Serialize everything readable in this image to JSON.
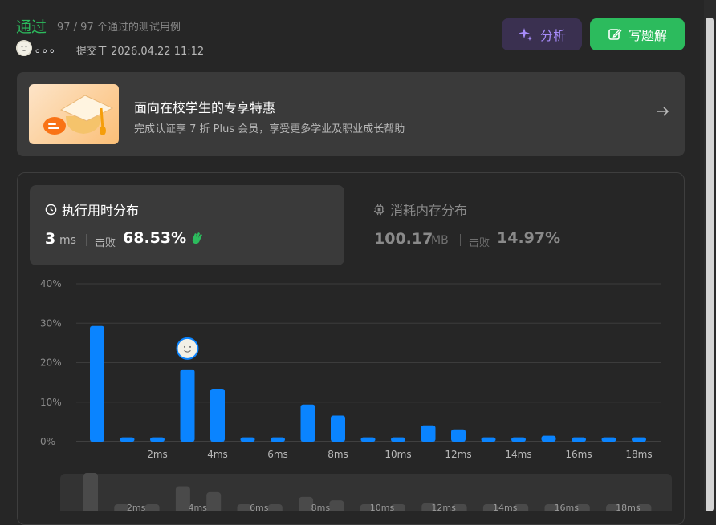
{
  "header": {
    "status": "通过",
    "testcases": "97 / 97 个通过的测试用例",
    "username": "。。。",
    "submitted": "提交于 2026.04.22 11:12",
    "analyze_label": "分析",
    "solution_label": "写题解"
  },
  "promo": {
    "title": "面向在校学生的专享特惠",
    "subtitle": "完成认证享 7 折 Plus 会员，享受更多学业及职业成长帮助"
  },
  "runtime": {
    "title": "执行用时分布",
    "value": "3",
    "unit": "ms",
    "beats_label": "击败",
    "beats": "68.53%"
  },
  "memory": {
    "title": "消耗内存分布",
    "value": "100.17",
    "unit": "MB",
    "beats_label": "击败",
    "beats": "14.97%"
  },
  "colors": {
    "accepted": "#2cbb5d",
    "bar": "#0a84ff",
    "analyze": "#a78bfa",
    "mini_bar": "#4a4a4a"
  },
  "chart_data": {
    "type": "bar",
    "y_ticks": [
      "40%",
      "30%",
      "20%",
      "10%",
      "0%"
    ],
    "ylim": [
      0,
      40
    ],
    "x_tick_labels": [
      "2ms",
      "4ms",
      "6ms",
      "8ms",
      "10ms",
      "12ms",
      "14ms",
      "16ms",
      "18ms"
    ],
    "values": [
      29.3,
      1.1,
      1.1,
      18.3,
      13.4,
      1.1,
      1.1,
      9.4,
      6.6,
      1.1,
      1.1,
      4.1,
      3.1,
      1.1,
      1.1,
      1.5,
      1.1,
      1.1,
      1.1
    ],
    "highlight_index": 3,
    "grid": true
  },
  "minimap": {
    "x_tick_labels": [
      "2ms",
      "4ms",
      "6ms",
      "8ms",
      "10ms",
      "12ms",
      "14ms",
      "16ms",
      "18ms"
    ]
  }
}
